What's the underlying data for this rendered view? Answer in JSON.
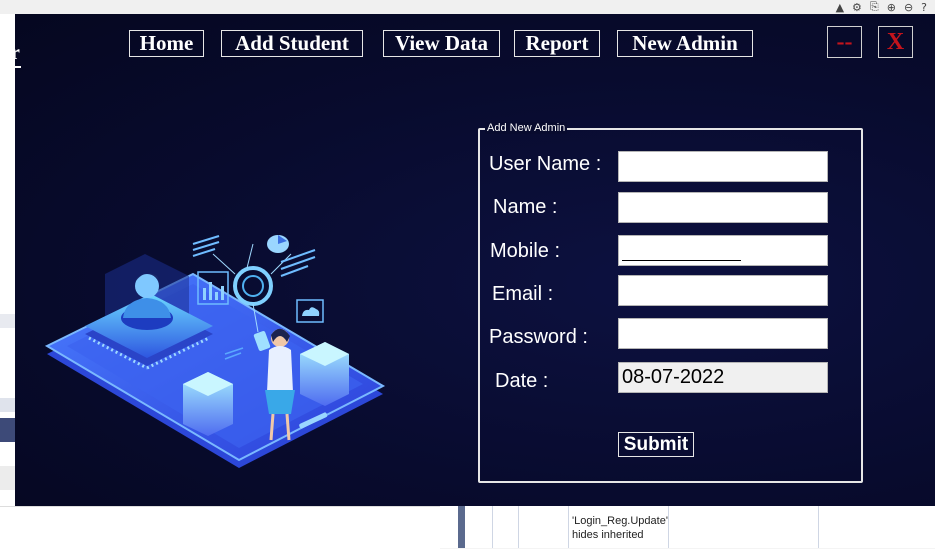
{
  "window": {
    "left_clip_text": "or"
  },
  "nav": {
    "home": "Home",
    "add_student": "Add Student",
    "view_data": "View Data",
    "report": "Report",
    "new_admin": "New Admin"
  },
  "window_controls": {
    "minimize": "--",
    "close": "X"
  },
  "form": {
    "legend": "Add New Admin",
    "labels": {
      "user_name": "User Name :",
      "name": "Name :",
      "mobile": "Mobile :",
      "email": "Email :",
      "password": "Password :",
      "date": "Date :"
    },
    "values": {
      "user_name": "",
      "name": "",
      "mobile": "",
      "email": "",
      "password": "",
      "date": "08-07-2022"
    },
    "submit": "Submit"
  },
  "background": {
    "grid_cell_text": "'Login_Reg.Update' hides inherited"
  },
  "colors": {
    "background": "#080b2e",
    "accent_red": "#c4141c",
    "text": "#ffffff"
  }
}
